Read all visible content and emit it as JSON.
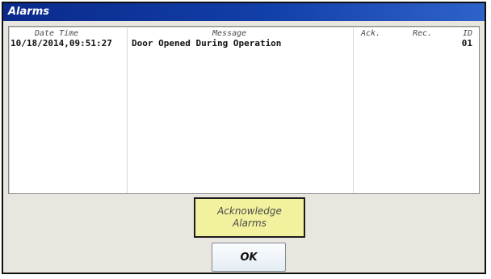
{
  "window": {
    "title": "Alarms"
  },
  "alarm_table": {
    "headers": {
      "date_time": "Date Time",
      "message": "Message",
      "ack": "Ack.",
      "rec": "Rec.",
      "id": "ID"
    },
    "rows": [
      {
        "date_time": "10/18/2014,09:51:27",
        "message": "Door Opened During Operation",
        "ack": "",
        "rec": "",
        "id": "01"
      }
    ]
  },
  "buttons": {
    "acknowledge_line1": "Acknowledge",
    "acknowledge_line2": "Alarms",
    "ok": "OK"
  },
  "colors": {
    "title_bar": "#123fa8",
    "acknowledge_button": "#f2f29e",
    "panel_background": "#e9e6e0"
  }
}
